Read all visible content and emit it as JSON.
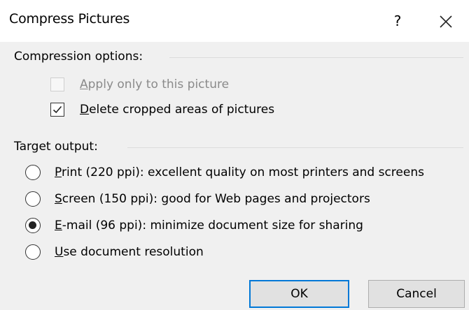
{
  "dialog": {
    "title": "Compress Pictures",
    "help_label": "?",
    "close_icon": "close-icon"
  },
  "compression_options": {
    "label": "Compression options:",
    "apply_only": {
      "label_mnemonic": "A",
      "label_rest": "pply only to this picture",
      "checked": false,
      "disabled": true
    },
    "delete_cropped": {
      "label_mnemonic": "D",
      "label_rest": "elete cropped areas of pictures",
      "checked": true,
      "disabled": false
    }
  },
  "target_output": {
    "label": "Target output:",
    "selected": "email",
    "options": [
      {
        "id": "print",
        "mnemonic": "P",
        "rest": "rint (220 ppi): excellent quality on most printers and screens"
      },
      {
        "id": "screen",
        "mnemonic": "S",
        "rest": "creen (150 ppi): good for Web pages and projectors"
      },
      {
        "id": "email",
        "mnemonic": "E",
        "rest": "-mail (96 ppi): minimize document size for sharing"
      },
      {
        "id": "document",
        "mnemonic": "U",
        "rest": "se document resolution"
      }
    ]
  },
  "buttons": {
    "ok_label": "OK",
    "cancel_label": "Cancel"
  },
  "colors": {
    "accent": "#0078d7",
    "panel_bg": "#f0f0f0",
    "button_bg": "#e1e1e1",
    "disabled_text": "#8a8a8a"
  }
}
